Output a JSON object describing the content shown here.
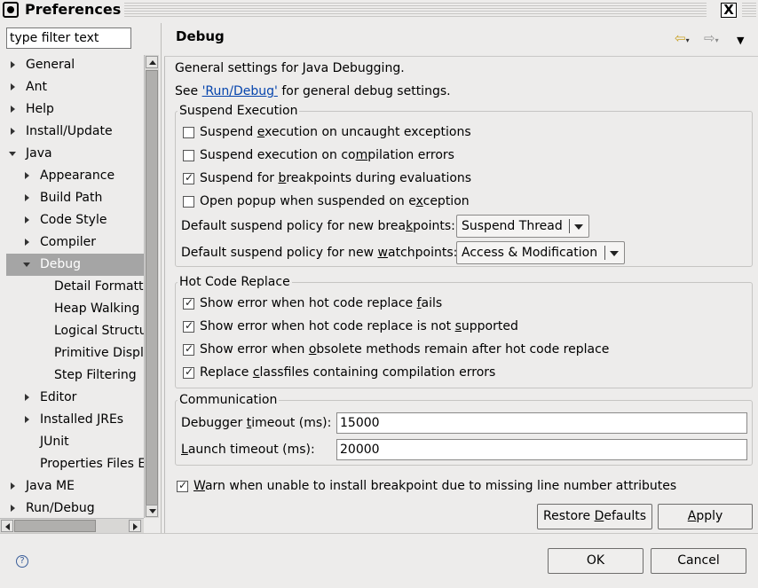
{
  "window": {
    "title": "Preferences",
    "close_label": "X"
  },
  "filter": {
    "placeholder": "type filter text"
  },
  "tree": [
    {
      "label": "General",
      "arrow": "right",
      "level": 0
    },
    {
      "label": "Ant",
      "arrow": "right",
      "level": 0
    },
    {
      "label": "Help",
      "arrow": "right",
      "level": 0
    },
    {
      "label": "Install/Update",
      "arrow": "right",
      "level": 0
    },
    {
      "label": "Java",
      "arrow": "down",
      "level": 0
    },
    {
      "label": "Appearance",
      "arrow": "right",
      "level": 1
    },
    {
      "label": "Build Path",
      "arrow": "right",
      "level": 1
    },
    {
      "label": "Code Style",
      "arrow": "right",
      "level": 1
    },
    {
      "label": "Compiler",
      "arrow": "right",
      "level": 1
    },
    {
      "label": "Debug",
      "arrow": "down",
      "level": 1,
      "selected": true
    },
    {
      "label": "Detail Formatte",
      "arrow": "none",
      "level": 2
    },
    {
      "label": "Heap Walking",
      "arrow": "none",
      "level": 2
    },
    {
      "label": "Logical Structu",
      "arrow": "none",
      "level": 2
    },
    {
      "label": "Primitive Displa",
      "arrow": "none",
      "level": 2
    },
    {
      "label": "Step Filtering",
      "arrow": "none",
      "level": 2
    },
    {
      "label": "Editor",
      "arrow": "right",
      "level": 1
    },
    {
      "label": "Installed JREs",
      "arrow": "right",
      "level": 1
    },
    {
      "label": "JUnit",
      "arrow": "none",
      "level": 1
    },
    {
      "label": "Properties Files E",
      "arrow": "none",
      "level": 1
    },
    {
      "label": "Java ME",
      "arrow": "right",
      "level": 0
    },
    {
      "label": "Run/Debug",
      "arrow": "right",
      "level": 0
    }
  ],
  "page": {
    "title": "Debug",
    "description": "General settings for Java Debugging.",
    "see_prefix": "See ",
    "see_link": "'Run/Debug'",
    "see_suffix": " for general debug settings."
  },
  "suspend": {
    "group_label": "Suspend Execution",
    "checkboxes": [
      {
        "pre": "Suspend ",
        "mn": "e",
        "post": "xecution on uncaught exceptions",
        "checked": false
      },
      {
        "pre": "Suspend execution on co",
        "mn": "m",
        "post": "pilation errors",
        "checked": false
      },
      {
        "pre": "Suspend for ",
        "mn": "b",
        "post": "reakpoints during evaluations",
        "checked": true
      },
      {
        "pre": "Open popup when suspended on e",
        "mn": "x",
        "post": "ception",
        "checked": false
      }
    ],
    "bp_label_pre": "Default suspend policy for new brea",
    "bp_label_mn": "k",
    "bp_label_post": "points:",
    "bp_value": "Suspend Thread",
    "wp_label_pre": "Default suspend policy for new ",
    "wp_label_mn": "w",
    "wp_label_post": "atchpoints:",
    "wp_value": "Access & Modification"
  },
  "hcr": {
    "group_label": "Hot Code Replace",
    "checkboxes": [
      {
        "pre": "Show error when hot code replace ",
        "mn": "f",
        "post": "ails",
        "checked": true
      },
      {
        "pre": "Show error when hot code replace is not ",
        "mn": "s",
        "post": "upported",
        "checked": true
      },
      {
        "pre": "Show error when ",
        "mn": "o",
        "post": "bsolete methods remain after hot code replace",
        "checked": true
      },
      {
        "pre": "Replace ",
        "mn": "c",
        "post": "lassfiles containing compilation errors",
        "checked": true
      }
    ]
  },
  "comm": {
    "group_label": "Communication",
    "debugger_label_pre": "Debugger ",
    "debugger_label_mn": "t",
    "debugger_label_post": "imeout (ms):",
    "debugger_value": "15000",
    "launch_label_pre": "",
    "launch_label_mn": "L",
    "launch_label_post": "aunch timeout (ms):",
    "launch_value": "20000"
  },
  "warn": {
    "pre": "",
    "mn": "W",
    "post": "arn when unable to install breakpoint due to missing line number attributes",
    "checked": true
  },
  "buttons": {
    "restore_pre": "Restore ",
    "restore_mn": "D",
    "restore_post": "efaults",
    "apply_pre": "",
    "apply_mn": "A",
    "apply_post": "pply",
    "ok": "OK",
    "cancel": "Cancel"
  },
  "icons": {
    "back": "back-arrow-icon",
    "forward": "forward-arrow-icon",
    "menu": "view-menu-icon",
    "help": "help-icon"
  }
}
